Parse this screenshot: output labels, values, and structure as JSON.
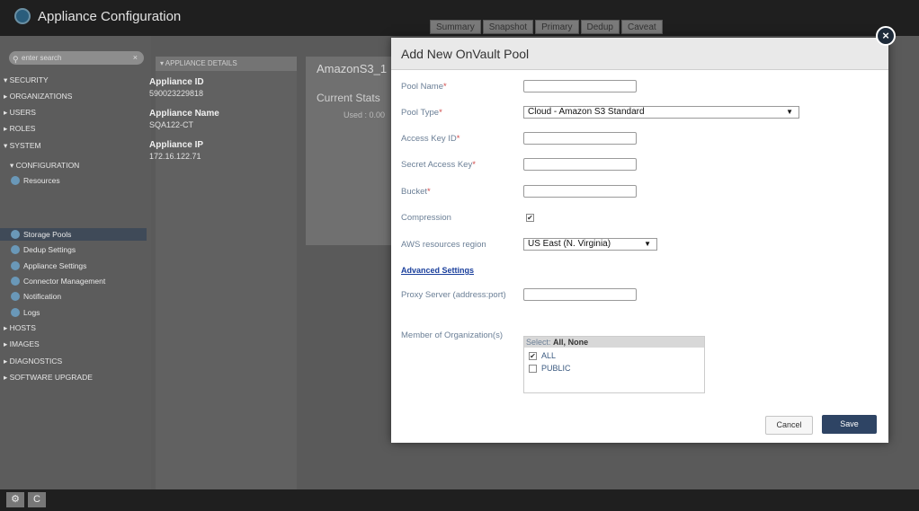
{
  "app": {
    "title": "Appliance Configuration"
  },
  "tabs": [
    "Summary",
    "Snapshot",
    "Primary",
    "Dedup",
    "Caveat"
  ],
  "sidebar": {
    "search_placeholder": "enter search",
    "items": [
      {
        "label": "SECURITY"
      },
      {
        "label": "ORGANIZATIONS"
      },
      {
        "label": "USERS"
      },
      {
        "label": "ROLES"
      },
      {
        "label": "SYSTEM"
      },
      {
        "label": "CONFIGURATION"
      },
      {
        "label": "Resources"
      },
      {
        "label": "Storage Pools"
      },
      {
        "label": "Dedup Settings"
      },
      {
        "label": "Appliance Settings"
      },
      {
        "label": "Connector Management"
      },
      {
        "label": "Notification"
      },
      {
        "label": "Logs"
      },
      {
        "label": "HOSTS"
      },
      {
        "label": "IMAGES"
      },
      {
        "label": "DIAGNOSTICS"
      },
      {
        "label": "SOFTWARE UPGRADE"
      }
    ],
    "selected": "Storage Pools"
  },
  "details": {
    "header": "APPLIANCE DETAILS",
    "appliance_id_label": "Appliance ID",
    "appliance_id": "590023229818",
    "appliance_name_label": "Appliance Name",
    "appliance_name": "SQA122-CT",
    "appliance_ip_label": "Appliance IP",
    "appliance_ip": "172.16.122.71"
  },
  "main": {
    "title": "AmazonS3_1",
    "current_stats": "Current Stats",
    "used": "Used : 0.00"
  },
  "bottom": {
    "settings_icon": "⚙",
    "refresh_label": "C"
  },
  "modal": {
    "title": "Add New OnVault Pool",
    "pool_name_label": "Pool Name",
    "pool_name_value": "",
    "pool_type_label": "Pool Type",
    "pool_type_value": "Cloud - Amazon S3 Standard",
    "access_key_label": "Access Key ID",
    "secret_key_label": "Secret Access Key",
    "bucket_label": "Bucket",
    "compression_label": "Compression",
    "compression_checked": true,
    "region_label": "AWS resources region",
    "region_value": "US East (N. Virginia)",
    "advanced_link": "Advanced Settings",
    "proxy_label": "Proxy Server (address:port)",
    "org_label": "Member of Organization(s)",
    "org_select_prefix": "Select:",
    "org_select_all": "All",
    "org_select_none": "None",
    "org_options": [
      {
        "label": "ALL",
        "checked": true
      },
      {
        "label": "PUBLIC",
        "checked": false
      }
    ],
    "cancel_label": "Cancel",
    "save_label": "Save",
    "required_mark": "*"
  },
  "colors": {
    "accent": "#2e4464",
    "label": "#6b7f96",
    "required": "#d14a4a",
    "link": "#1a3f9c"
  }
}
